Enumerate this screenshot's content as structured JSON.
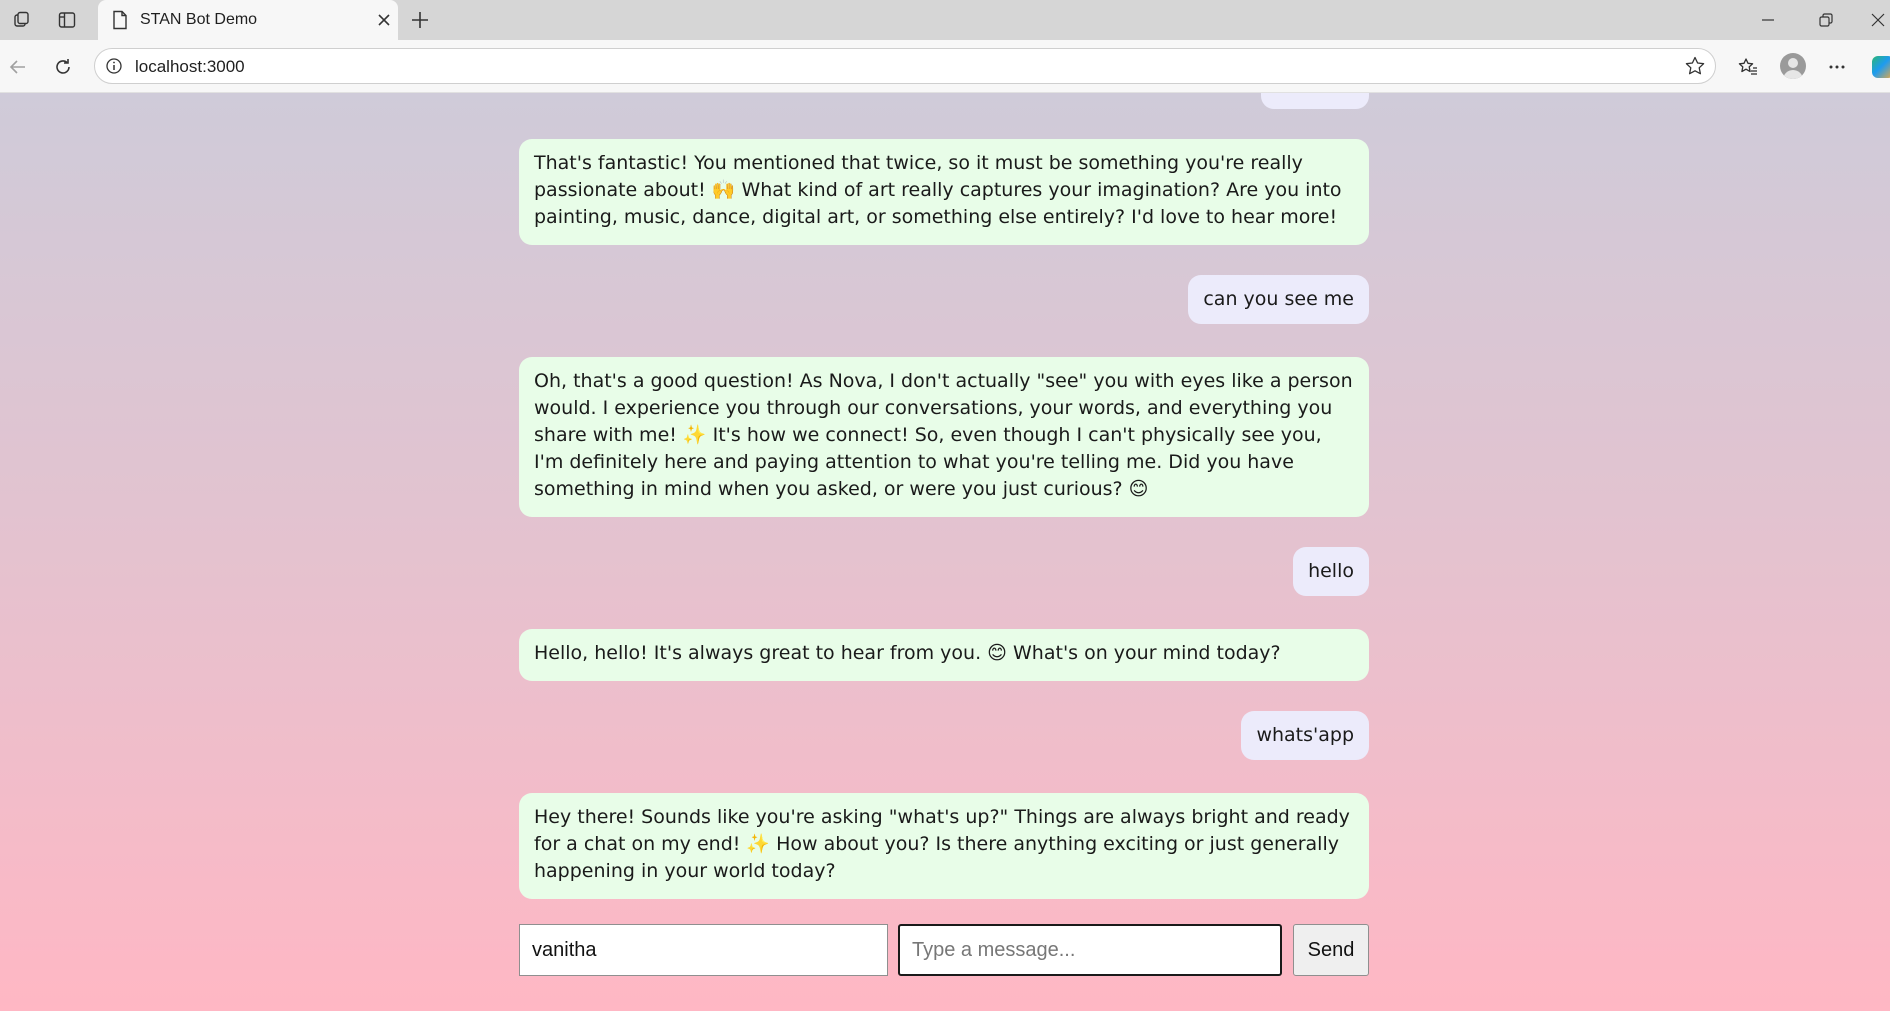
{
  "browser": {
    "tab_title": "STAN Bot Demo",
    "url": "localhost:3000",
    "icons": [
      "workspaces-icon",
      "vertical-tabs-icon",
      "page-icon",
      "close-icon",
      "plus-icon",
      "minimize-icon",
      "restore-icon",
      "window-close-icon",
      "back-icon",
      "refresh-icon",
      "info-icon",
      "star-icon",
      "favorites-icon",
      "profile-avatar",
      "more-icon",
      "copilot-icon"
    ]
  },
  "chat": {
    "messages": [
      {
        "role": "user",
        "text": ""
      },
      {
        "role": "bot",
        "text": "That's fantastic! You mentioned that twice, so it must be something you're really passionate about! 🙌 What kind of art really captures your imagination? Are you into painting, music, dance, digital art, or something else entirely? I'd love to hear more!"
      },
      {
        "role": "user",
        "text": "can you see me"
      },
      {
        "role": "bot",
        "text": "Oh, that's a good question! As Nova, I don't actually \"see\" you with eyes like a person would. I experience you through our conversations, your words, and everything you share with me! ✨ It's how we connect! So, even though I can't physically see you, I'm definitely here and paying attention to what you're telling me. Did you have something in mind when you asked, or were you just curious? 😊"
      },
      {
        "role": "user",
        "text": "hello"
      },
      {
        "role": "bot",
        "text": "Hello, hello! It's always great to hear from you. 😊 What's on your mind today?"
      },
      {
        "role": "user",
        "text": "whats'app"
      },
      {
        "role": "bot",
        "text": "Hey there! Sounds like you're asking \"what's up?\" Things are always bright and ready for a chat on my end! ✨ How about you? Is there anything exciting or just generally happening in your world today?"
      }
    ]
  },
  "composer": {
    "name_value": "vanitha",
    "message_placeholder": "Type a message...",
    "message_value": "",
    "send_label": "Send"
  },
  "colors": {
    "user_bubble": "#ecebfb",
    "bot_bubble": "#e8fde8",
    "page_gradient_top": "#cfcbd9",
    "page_gradient_bottom": "#ffb7c4"
  }
}
